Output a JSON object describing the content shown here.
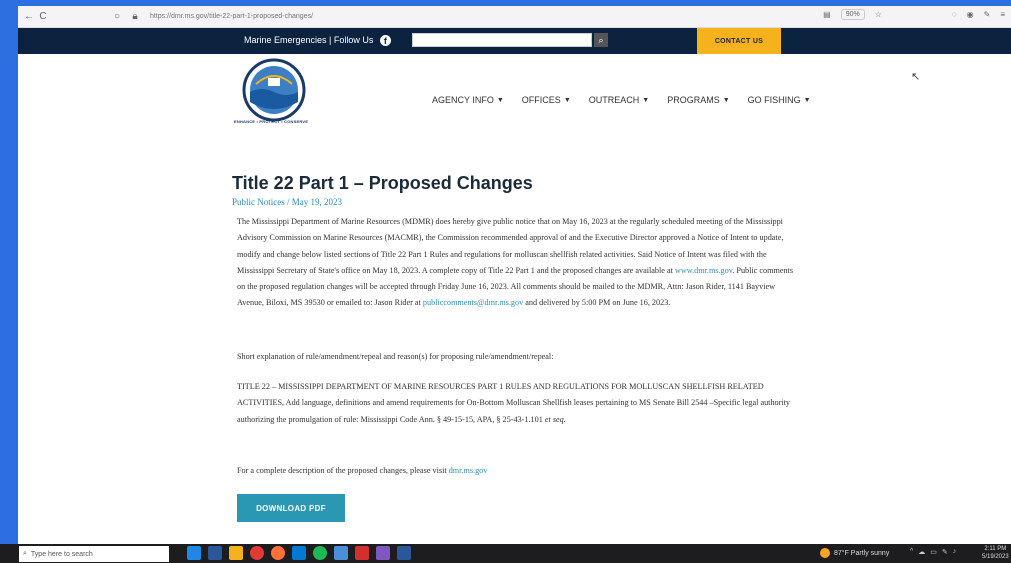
{
  "browser": {
    "url": "https://dmr.ms.gov/title-22-part-1-proposed-changes/",
    "zoom": "90%"
  },
  "topbar": {
    "emergency_text": "Marine Emergencies | Follow Us",
    "contact_label": "CONTACT US"
  },
  "logo": {
    "tagline": "ENHANCE • PROTECT • CONSERVE"
  },
  "nav": {
    "items": [
      {
        "label": "AGENCY INFO"
      },
      {
        "label": "OFFICES"
      },
      {
        "label": "OUTREACH"
      },
      {
        "label": "PROGRAMS"
      },
      {
        "label": "GO FISHING"
      }
    ]
  },
  "article": {
    "title": "Title 22 Part 1 – Proposed Changes",
    "meta": "Public Notices / May 19, 2023",
    "p1_a": "The Mississippi Department of Marine Resources (MDMR) does hereby give public notice that on May 16, 2023 at the regularly scheduled meeting of the Mississippi Advisory Commission on Marine Resources (MACMR), the Commission recommended approval of and the Executive Director approved a Notice of Intent to update, modify and change below listed sections of Title 22 Part 1 Rules and regulations for molluscan shellfish related activities. Said Notice of Intent was filed with the Mississippi Secretary of State's office on May 18, 2023. A complete copy of Title 22 Part 1 and the proposed changes are available at",
    "p1_link1": "www.dmr.ms.gov",
    "p1_b": ". Public comments on the proposed regulation changes will be accepted through Friday June 16, 2023. All comments should be mailed to the MDMR, Attn: Jason Rider, 1141 Bayview Avenue, Biloxi, MS 39530 or emailed to: Jason Rider at",
    "p1_link2": "publiccomments@dmr.ms.gov",
    "p1_c": "and delivered by 5:00 PM on June 16, 2023.",
    "p2": "Short explanation of rule/amendment/repeal and reason(s) for proposing rule/amendment/repeal:",
    "p3_a": "TITLE 22 – MISSISSIPPI DEPARTMENT OF MARINE RESOURCES PART 1 RULES AND REGULATIONS FOR MOLLUSCAN SHELLFISH RELATED ACTIVITIES, Add language, definitions and amend requirements for On-Bottom Molluscan Shellfish leases pertaining to MS Senate Bill 2544 –Specific legal authority authorizing the promulgation of rule: Mississippi Code Ann. § 49-15-15, APA, § 25-43-1.101",
    "p3_em": "et seq.",
    "p4_a": "For a complete description of the proposed changes, please visit",
    "p4_link": "dmr.ms.gov",
    "download_label": "DOWNLOAD PDF"
  },
  "taskbar": {
    "search_placeholder": "Type here to search",
    "weather": "87°F  Partly sunny",
    "time": "2:11 PM",
    "date": "5/19/2023"
  }
}
